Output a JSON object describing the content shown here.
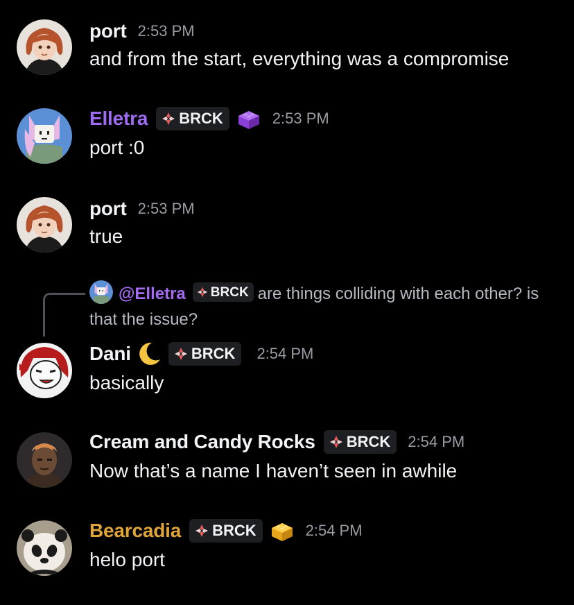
{
  "colors": {
    "background": "#000000",
    "elletra_name": "#9f6bf2",
    "bearcadia_name": "#e0a53a",
    "timestamp": "#9a9ca3",
    "tag_bg": "#1e1f22"
  },
  "messages": [
    {
      "author": "port",
      "time": "2:53 PM",
      "text": "and from the start, everything was a compromise",
      "avatar_icon": "anime-girl-avatar"
    },
    {
      "author": "Elletra",
      "tag": "BRCK",
      "role_icon": "purple-brick-icon",
      "time": "2:53 PM",
      "text": "port :0",
      "avatar_icon": "pink-hair-avatar"
    },
    {
      "author": "port",
      "time": "2:53 PM",
      "text": "true",
      "avatar_icon": "anime-girl-avatar"
    },
    {
      "reply_to": {
        "mention": "@Elletra",
        "tag": "BRCK",
        "text": "are things colliding with each other? is that the issue?"
      },
      "author": "Dani",
      "author_emoji": "crescent-moon-icon",
      "tag": "BRCK",
      "time": "2:54 PM",
      "text": "basically",
      "avatar_icon": "red-hair-character-avatar"
    },
    {
      "author": "Cream and Candy Rocks",
      "tag": "BRCK",
      "time": "2:54 PM",
      "text": "Now that’s a name I haven’t seen in awhile",
      "avatar_icon": "man-portrait-avatar"
    },
    {
      "author": "Bearcadia",
      "tag": "BRCK",
      "role_icon": "yellow-brick-icon",
      "time": "2:54 PM",
      "text": "helo port",
      "avatar_icon": "panda-avatar"
    }
  ]
}
